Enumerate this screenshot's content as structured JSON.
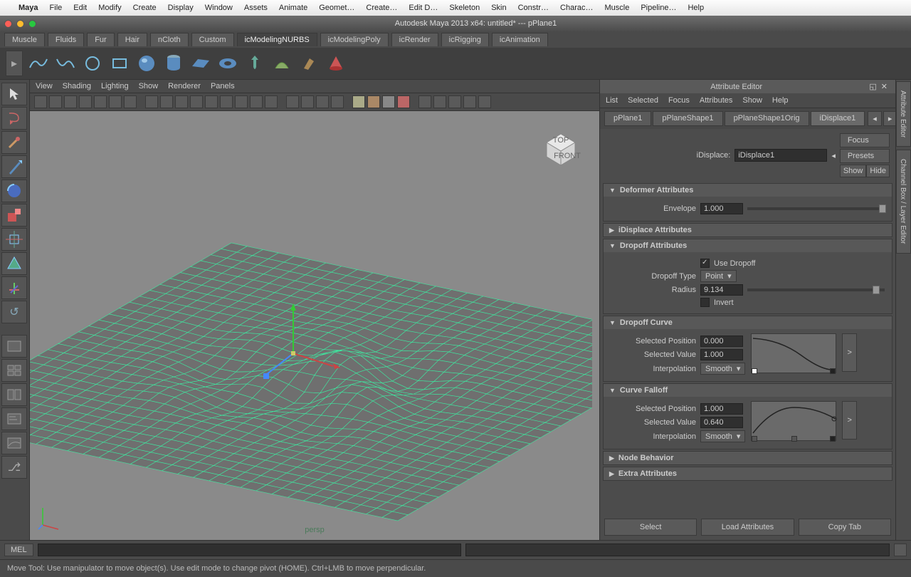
{
  "macmenu": [
    "Maya",
    "File",
    "Edit",
    "Modify",
    "Create",
    "Display",
    "Window",
    "Assets",
    "Animate",
    "Geomet…",
    "Create…",
    "Edit D…",
    "Skeleton",
    "Skin",
    "Constr…",
    "Charac…",
    "Muscle",
    "Pipeline…",
    "Help"
  ],
  "window_title": "Autodesk Maya 2013 x64: untitled*  ---  pPlane1",
  "shelf_tabs": [
    "Muscle",
    "Fluids",
    "Fur",
    "Hair",
    "nCloth",
    "Custom",
    "icModelingNURBS",
    "icModelingPoly",
    "icRender",
    "icRigging",
    "icAnimation"
  ],
  "shelf_active": 6,
  "viewport": {
    "menus": [
      "View",
      "Shading",
      "Lighting",
      "Show",
      "Renderer",
      "Panels"
    ],
    "persp_label": "persp"
  },
  "ae": {
    "title": "Attribute Editor",
    "header": [
      "List",
      "Selected",
      "Focus",
      "Attributes",
      "Show",
      "Help"
    ],
    "tabs": [
      "pPlane1",
      "pPlaneShape1",
      "pPlaneShape1Orig",
      "iDisplace1"
    ],
    "active_tab": 3,
    "nodetype_label": "iDisplace:",
    "nodename": "iDisplace1",
    "buttons": {
      "focus": "Focus",
      "presets": "Presets",
      "show": "Show",
      "hide": "Hide"
    },
    "deformer": {
      "title": "Deformer Attributes",
      "envelope_label": "Envelope",
      "envelope": "1.000"
    },
    "idisplace_title": "iDisplace Attributes",
    "dropoff": {
      "title": "Dropoff Attributes",
      "use_label": "Use Dropoff",
      "use": true,
      "type_label": "Dropoff Type",
      "type": "Point",
      "radius_label": "Radius",
      "radius": "9.134",
      "invert_label": "Invert",
      "invert": false
    },
    "dropoffcurve": {
      "title": "Dropoff Curve",
      "pos_label": "Selected Position",
      "pos": "0.000",
      "val_label": "Selected Value",
      "val": "1.000",
      "interp_label": "Interpolation",
      "interp": "Smooth"
    },
    "falloff": {
      "title": "Curve Falloff",
      "pos_label": "Selected Position",
      "pos": "1.000",
      "val_label": "Selected Value",
      "val": "0.640",
      "interp_label": "Interpolation",
      "interp": "Smooth"
    },
    "node_behavior": "Node Behavior",
    "extra": "Extra Attributes",
    "footer": {
      "select": "Select",
      "load": "Load Attributes",
      "copy": "Copy Tab"
    }
  },
  "rtabs": [
    "Attribute Editor",
    "Channel Box / Layer Editor"
  ],
  "mel_label": "MEL",
  "status": "Move Tool: Use manipulator to move object(s). Use edit mode to change pivot (HOME).  Ctrl+LMB to move perpendicular."
}
